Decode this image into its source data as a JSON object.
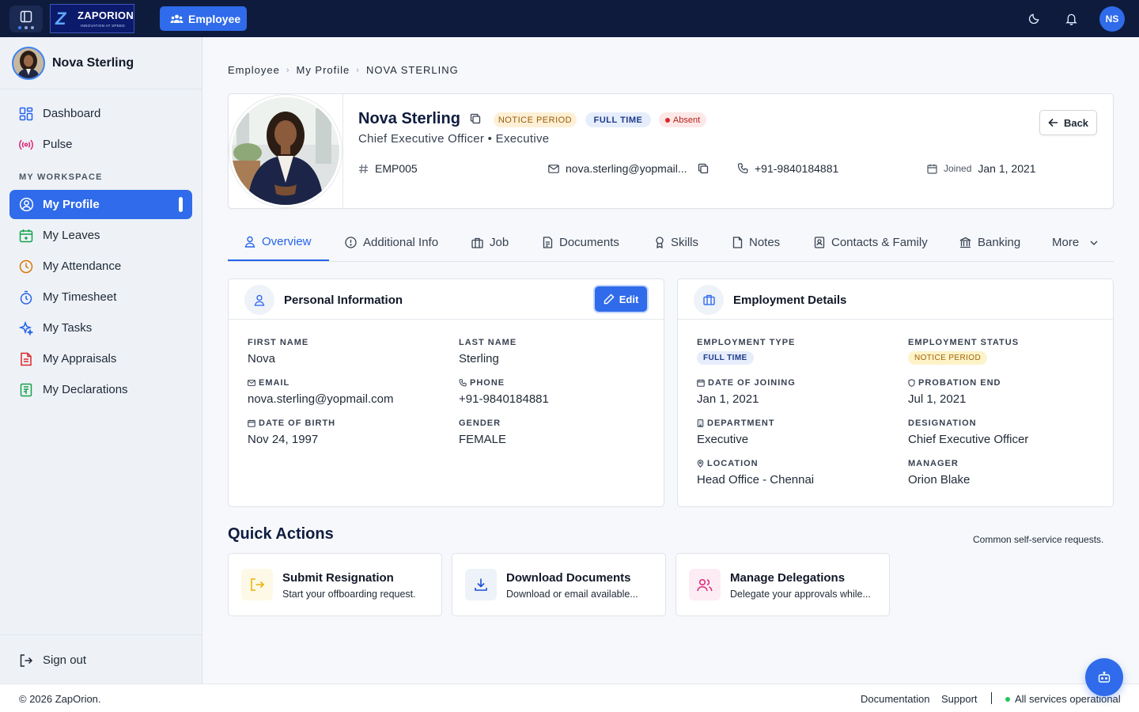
{
  "app": {
    "logo_text": "ZAPORION",
    "logo_tagline": "INNOVATION AT SPEED",
    "module_button": "Employee",
    "user_initials": "NS"
  },
  "sidebar": {
    "user_name": "Nova Sterling",
    "items_top": [
      {
        "label": "Dashboard",
        "icon": "dashboard-icon"
      },
      {
        "label": "Pulse",
        "icon": "pulse-icon"
      }
    ],
    "workspace_label": "MY WORKSPACE",
    "items_workspace": [
      {
        "label": "My Profile",
        "icon": "user-circle-icon",
        "active": true
      },
      {
        "label": "My Leaves",
        "icon": "calendar-icon"
      },
      {
        "label": "My Attendance",
        "icon": "clock-icon"
      },
      {
        "label": "My Timesheet",
        "icon": "stopwatch-icon"
      },
      {
        "label": "My Tasks",
        "icon": "sparkle-icon"
      },
      {
        "label": "My Appraisals",
        "icon": "document-icon"
      },
      {
        "label": "My Declarations",
        "icon": "receipt-icon"
      }
    ],
    "sign_out": "Sign out"
  },
  "breadcrumb": [
    "Employee",
    "My Profile",
    "NOVA STERLING"
  ],
  "profile": {
    "name": "Nova Sterling",
    "badge_notice": "NOTICE PERIOD",
    "badge_type": "FULL TIME",
    "badge_status": "Absent",
    "subtitle": "Chief Executive Officer • Executive",
    "emp_id": "EMP005",
    "email": "nova.sterling@yopmail...",
    "phone": "+91-9840184881",
    "joined_label": "Joined",
    "joined_value": "Jan 1, 2021",
    "back_label": "Back"
  },
  "tabs": [
    {
      "label": "Overview",
      "active": true
    },
    {
      "label": "Additional Info"
    },
    {
      "label": "Job"
    },
    {
      "label": "Documents"
    },
    {
      "label": "Skills"
    },
    {
      "label": "Notes"
    },
    {
      "label": "Contacts & Family"
    },
    {
      "label": "Banking"
    },
    {
      "label": "More"
    }
  ],
  "personal": {
    "title": "Personal Information",
    "edit_label": "Edit",
    "first_name_label": "FIRST NAME",
    "first_name": "Nova",
    "last_name_label": "LAST NAME",
    "last_name": "Sterling",
    "email_label": "EMAIL",
    "email": "nova.sterling@yopmail.com",
    "phone_label": "PHONE",
    "phone": "+91-9840184881",
    "dob_label": "DATE OF BIRTH",
    "dob": "Nov 24, 1997",
    "gender_label": "GENDER",
    "gender": "FEMALE"
  },
  "employment": {
    "title": "Employment Details",
    "type_label": "EMPLOYMENT TYPE",
    "type": "FULL TIME",
    "status_label": "EMPLOYMENT STATUS",
    "status": "NOTICE PERIOD",
    "doj_label": "DATE OF JOINING",
    "doj": "Jan 1, 2021",
    "probation_label": "PROBATION END",
    "probation": "Jul 1, 2021",
    "dept_label": "DEPARTMENT",
    "dept": "Executive",
    "designation_label": "DESIGNATION",
    "designation": "Chief Executive Officer",
    "location_label": "LOCATION",
    "location": "Head Office - Chennai",
    "manager_label": "MANAGER",
    "manager": "Orion Blake"
  },
  "quick_actions": {
    "title": "Quick Actions",
    "subtitle": "Common self-service requests.",
    "items": [
      {
        "title": "Submit Resignation",
        "desc": "Start your offboarding request."
      },
      {
        "title": "Download Documents",
        "desc": "Download or email available..."
      },
      {
        "title": "Manage Delegations",
        "desc": "Delegate your approvals while..."
      }
    ]
  },
  "footer": {
    "copyright": "© 2026 ZapOrion.",
    "documentation": "Documentation",
    "support": "Support",
    "status": "All services operational"
  },
  "colors": {
    "primary": "#2f6bea",
    "topbar": "#0e1b3d",
    "status_ok": "#22c55e"
  }
}
